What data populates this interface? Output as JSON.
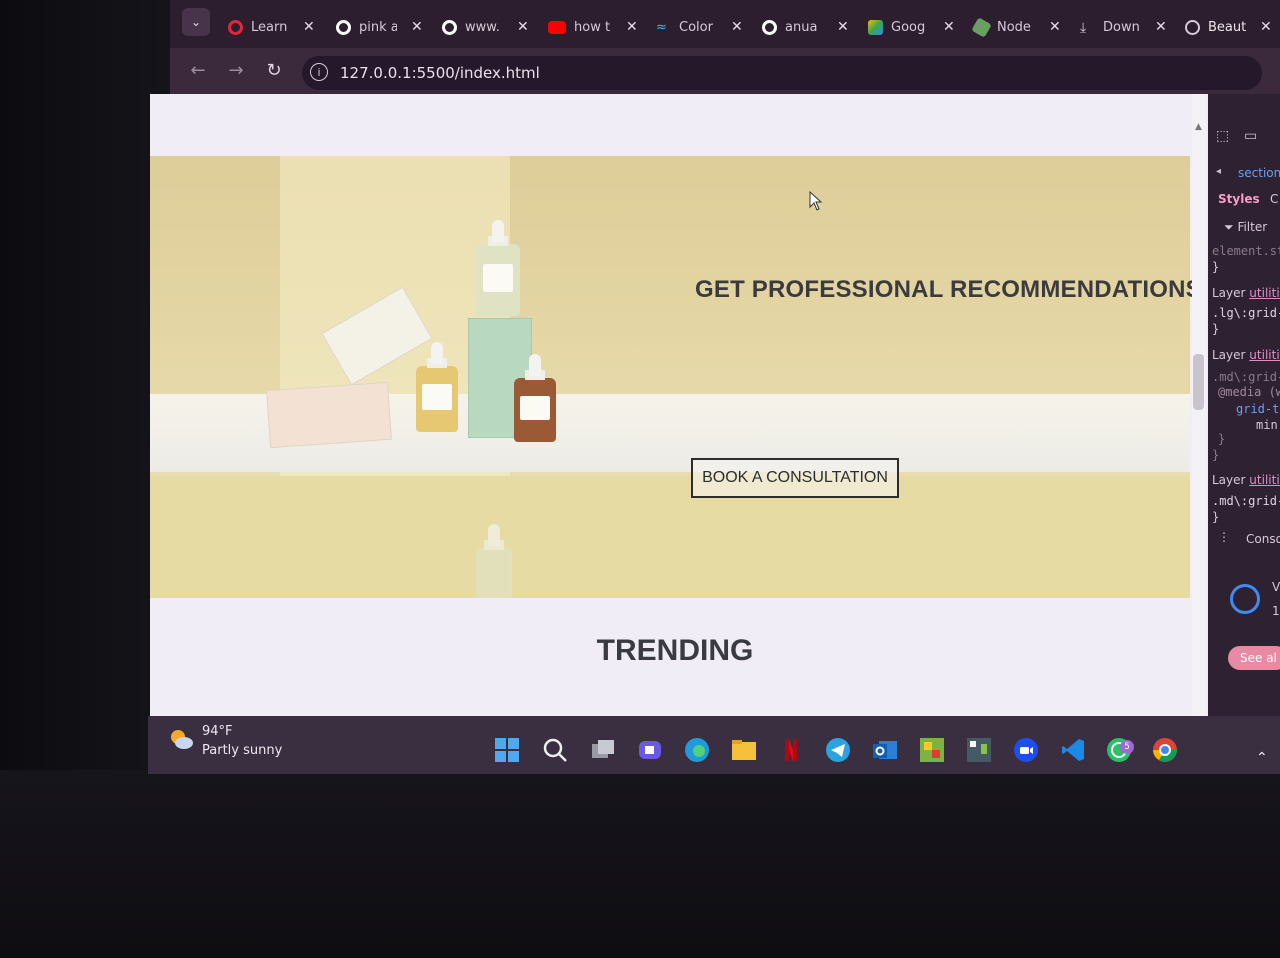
{
  "browser": {
    "tabs": [
      {
        "label": "Learn",
        "icon": "opera-icon",
        "color": "#e0283a"
      },
      {
        "label": "pink a",
        "icon": "google-icon",
        "color": "#ffffff"
      },
      {
        "label": "www.",
        "icon": "google-icon",
        "color": "#ffffff"
      },
      {
        "label": "how t",
        "icon": "youtube-icon",
        "color": "#ff0000"
      },
      {
        "label": "Color",
        "icon": "tailwind-icon",
        "color": "#38bdf8"
      },
      {
        "label": "anua",
        "icon": "google-icon",
        "color": "#ffffff"
      },
      {
        "label": "Goog",
        "icon": "google-ads-icon",
        "color": "#fbbc04"
      },
      {
        "label": "Node",
        "icon": "nodejs-icon",
        "color": "#68a063"
      },
      {
        "label": "Down",
        "icon": "download-icon",
        "color": "#d8c8d8"
      },
      {
        "label": "Beaut",
        "icon": "globe-icon",
        "color": "#d8c8d8",
        "active": true
      }
    ],
    "url": "127.0.0.1:5500/index.html"
  },
  "page": {
    "headline": "GET PROFESSIONAL RECOMMENDATIONS",
    "cta_label": "BOOK A CONSULTATION",
    "section_title": "TRENDING"
  },
  "devtools": {
    "breadcrumb": "section",
    "tab_styles": "Styles",
    "tab_computed": "C",
    "filter_label": "Filter",
    "rule_element": "element.st",
    "rule_close": "}",
    "layer_label": "Layer",
    "layer_link": "utilitie",
    "rule1": ".lg\\:grid-",
    "rule2": ".md\\:grid-",
    "media": "@media (w",
    "grid_t": "grid-t",
    "min": "min",
    "rule3": ".md\\:grid-",
    "console_label": "Conso",
    "see_all": "See al",
    "popup_text1": "V",
    "popup_text2": "1"
  },
  "taskbar": {
    "weather_temp": "94°F",
    "weather_desc": "Partly sunny",
    "whatsapp_badge": "5"
  }
}
